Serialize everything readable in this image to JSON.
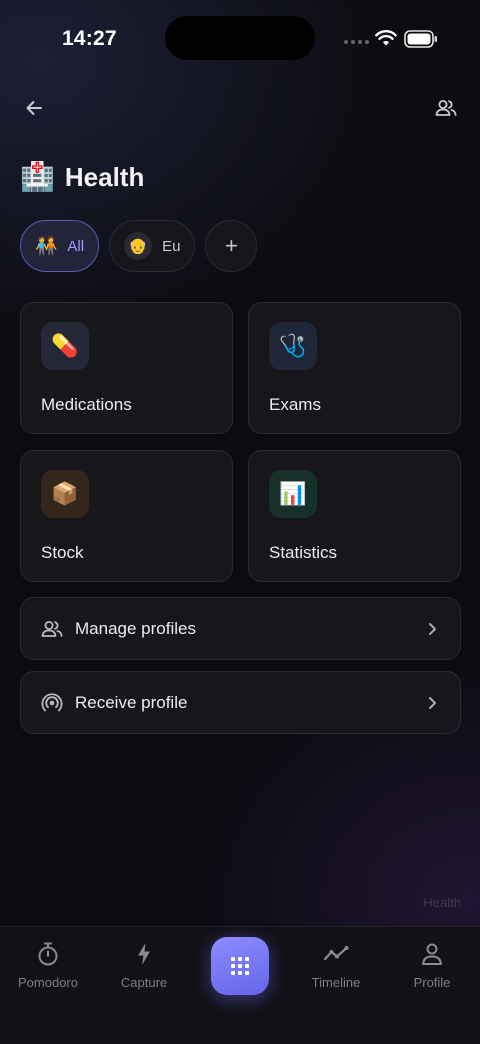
{
  "status": {
    "time": "14:27"
  },
  "header": {
    "title": "Health",
    "title_emoji": "🏥"
  },
  "filters": [
    {
      "label": "All",
      "emoji": "🧑‍🤝‍🧑",
      "active": true
    },
    {
      "label": "Eu",
      "emoji": "👴",
      "active": false
    },
    {
      "label": "+"
    }
  ],
  "cards": [
    {
      "label": "Medications",
      "emoji": "💊",
      "icon_bg": "#252836"
    },
    {
      "label": "Exams",
      "emoji": "🩺",
      "icon_bg": "#1e2638"
    },
    {
      "label": "Stock",
      "emoji": "📦",
      "icon_bg": "#33261a"
    },
    {
      "label": "Statistics",
      "emoji": "📊",
      "icon_bg": "#17302a"
    }
  ],
  "actions": [
    {
      "label": "Manage profiles"
    },
    {
      "label": "Receive profile"
    }
  ],
  "watermark": "Health",
  "tabs": [
    {
      "label": "Pomodoro"
    },
    {
      "label": "Capture"
    },
    {
      "label": "Timeline"
    },
    {
      "label": "Profile"
    }
  ],
  "colors": {
    "accent": "#7b7cf5",
    "background": "#0b0b10",
    "card": "#16161b"
  }
}
